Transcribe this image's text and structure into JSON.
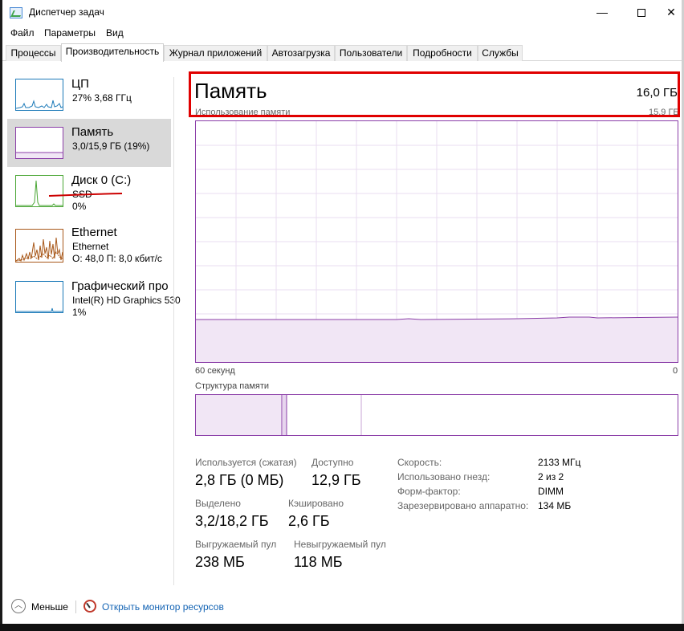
{
  "window": {
    "title": "Диспетчер задач",
    "minimize": "—",
    "close": "✕"
  },
  "menu": [
    "Файл",
    "Параметры",
    "Вид"
  ],
  "tabs": [
    "Процессы",
    "Производительность",
    "Журнал приложений",
    "Автозагрузка",
    "Пользователи",
    "Подробности",
    "Службы"
  ],
  "active_tab": "Производительность",
  "sidebar": {
    "items": [
      {
        "title": "ЦП",
        "line1": "27% 3,68 ГГц",
        "line2": "",
        "color": "#1c7ab8"
      },
      {
        "title": "Память",
        "line1": "3,0/15,9 ГБ (19%)",
        "line2": "",
        "color": "#8b3ea8"
      },
      {
        "title": "Диск 0 (C:)",
        "line1": "SSD",
        "line2": "0%",
        "color": "#4aa635"
      },
      {
        "title": "Ethernet",
        "line1": "Ethernet",
        "line2": "О: 48,0  П: 8,0 кбит/с",
        "color": "#a8581a"
      },
      {
        "title": "Графический про",
        "line1": "Intel(R) HD Graphics 530",
        "line2": "1%",
        "color": "#1c7ab8"
      }
    ]
  },
  "main": {
    "title": "Память",
    "total": "16,0 ГБ",
    "usage_label": "Использование памяти",
    "usage_max": "15,9 ГБ",
    "axis_left": "60 секунд",
    "axis_right": "0",
    "structure_label": "Структура памяти",
    "usage_level": 0.18
  },
  "stats": {
    "in_use_label": "Используется (сжатая)",
    "in_use_value": "2,8 ГБ (0 МБ)",
    "available_label": "Доступно",
    "available_value": "12,9 ГБ",
    "committed_label": "Выделено",
    "committed_value": "3,2/18,2 ГБ",
    "cached_label": "Кэшировано",
    "cached_value": "2,6 ГБ",
    "paged_label": "Выгружаемый пул",
    "paged_value": "238 МБ",
    "nonpaged_label": "Невыгружаемый пул",
    "nonpaged_value": "118 МБ"
  },
  "specs": [
    {
      "label": "Скорость:",
      "value": "2133 МГц"
    },
    {
      "label": "Использовано гнезд:",
      "value": "2 из 2"
    },
    {
      "label": "Форм-фактор:",
      "value": "DIMM"
    },
    {
      "label": "Зарезервировано аппаратно:",
      "value": "134 МБ"
    }
  ],
  "footer": {
    "fewer_details": "Меньше",
    "open_monitor": "Открыть монитор ресурсов"
  },
  "colors": {
    "memory_accent": "#8b3ea8",
    "highlight": "#e00000",
    "annotation": "#cc0000",
    "link": "#1464b4"
  }
}
